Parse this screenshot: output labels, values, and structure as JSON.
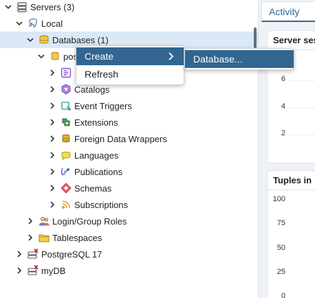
{
  "tree": {
    "servers_label": "Servers (3)",
    "local_label": "Local",
    "databases_label": "Databases (1)",
    "postgres_label": "pos",
    "catalogs_label": "Catalogs",
    "event_triggers_label": "Event Triggers",
    "extensions_label": "Extensions",
    "fdw_label": "Foreign Data Wrappers",
    "languages_label": "Languages",
    "publications_label": "Publications",
    "schemas_label": "Schemas",
    "subscriptions_label": "Subscriptions",
    "login_roles_label": "Login/Group Roles",
    "tablespaces_label": "Tablespaces",
    "pg17_label": "PostgreSQL 17",
    "mydb_label": "myDB"
  },
  "context_menu": {
    "create_label": "Create",
    "refresh_label": "Refresh",
    "submenu_database_label": "Database..."
  },
  "dashboard": {
    "tab_activity": "Activity",
    "card1_title": "Server ses",
    "card1_ticks": [
      "6",
      "4",
      "2"
    ],
    "card2_title": "Tuples in",
    "card2_ticks": [
      "100",
      "75",
      "50",
      "25",
      "0"
    ]
  },
  "colors": {
    "accent": "#326690",
    "selected_row": "#dbe9f7",
    "database_icon": "#e8b923",
    "error_x": "#d9232e"
  }
}
